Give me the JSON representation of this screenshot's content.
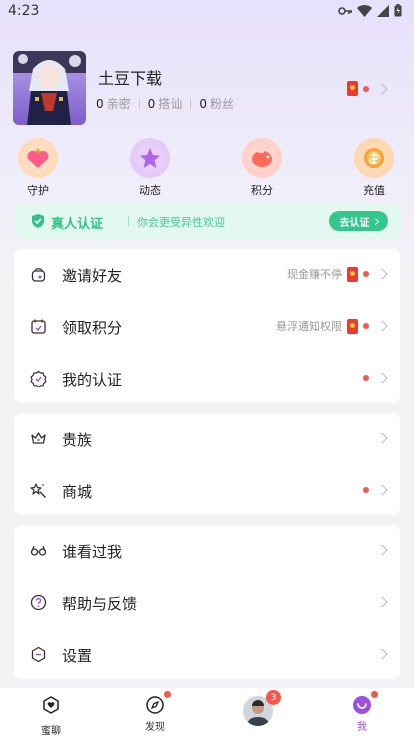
{
  "status_bar": {
    "time": "4:23"
  },
  "profile": {
    "nickname": "土豆下载",
    "stats": [
      {
        "count": "0",
        "label": "亲密"
      },
      {
        "count": "0",
        "label": "搭讪"
      },
      {
        "count": "0",
        "label": "粉丝"
      }
    ]
  },
  "quick_actions": [
    {
      "label": "守护",
      "icon": "heart-crown-icon"
    },
    {
      "label": "动态",
      "icon": "star-icon"
    },
    {
      "label": "积分",
      "icon": "piggy-bank-icon"
    },
    {
      "label": "充值",
      "icon": "coin-icon"
    }
  ],
  "verify_banner": {
    "title": "真人认证",
    "subtitle": "你会更受异性欢迎",
    "button": "去认证",
    "color": "#2fc28a"
  },
  "menu_groups": [
    [
      {
        "label": "邀请好友",
        "hint": "现金赚不停",
        "icon": "gift-bag-icon"
      },
      {
        "label": "领取积分",
        "hint": "悬浮通知权限",
        "icon": "calendar-icon"
      },
      {
        "label": "我的认证",
        "hint": "",
        "icon": "badge-check-icon"
      }
    ],
    [
      {
        "label": "贵族",
        "hint": "",
        "icon": "crown-icon"
      },
      {
        "label": "商城",
        "hint": "",
        "icon": "magic-wand-icon"
      }
    ],
    [
      {
        "label": "谁看过我",
        "hint": "",
        "icon": "glasses-icon"
      },
      {
        "label": "帮助与反馈",
        "hint": "",
        "icon": "help-icon"
      },
      {
        "label": "设置",
        "hint": "",
        "icon": "settings-icon"
      }
    ]
  ],
  "tabbar": {
    "tabs": [
      {
        "label": "蜜聊",
        "icon": "chat-heart-icon"
      },
      {
        "label": "发现",
        "icon": "compass-icon"
      },
      {
        "label": "",
        "icon": "avatar-tab"
      },
      {
        "label": "我",
        "icon": "me-icon"
      }
    ],
    "unread_count": "3",
    "active_color": "#9b51e0"
  }
}
